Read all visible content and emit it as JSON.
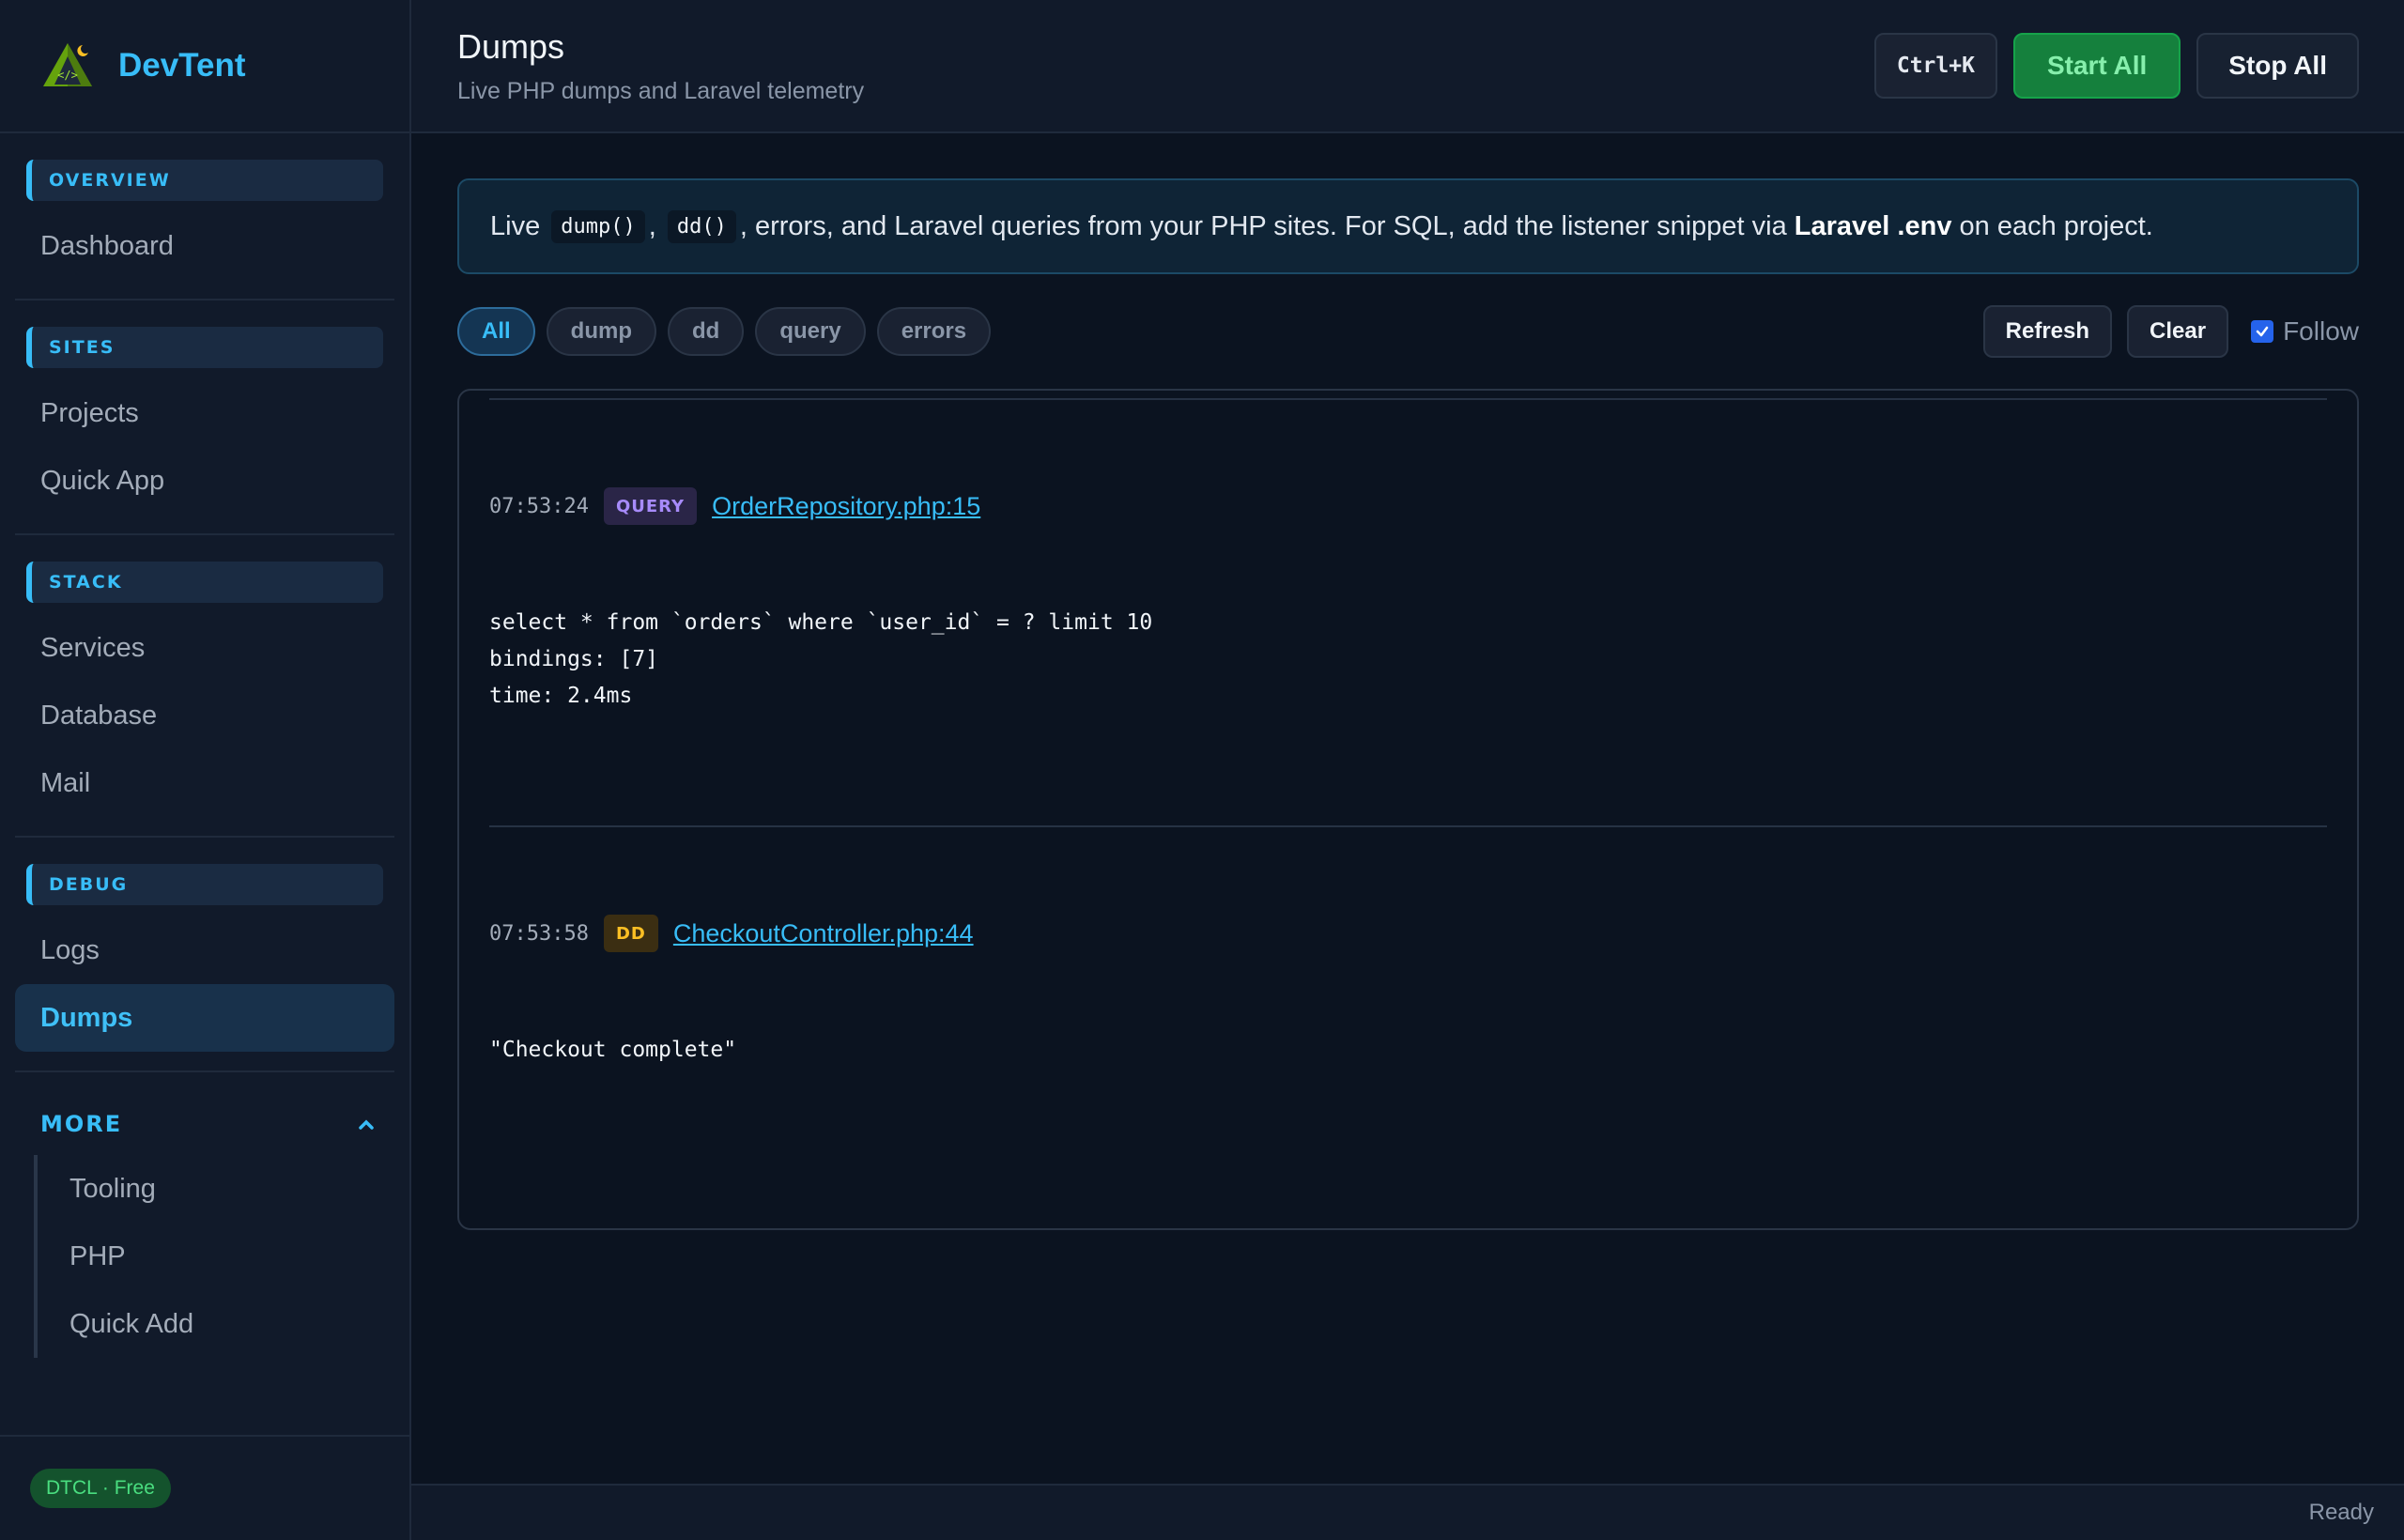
{
  "app": {
    "name": "DevTent",
    "plan_badge": "DTCL · Free"
  },
  "sidebar": {
    "sections": [
      {
        "heading": "OVERVIEW",
        "items": [
          {
            "label": "Dashboard"
          }
        ]
      },
      {
        "heading": "SITES",
        "items": [
          {
            "label": "Projects"
          },
          {
            "label": "Quick App"
          }
        ]
      },
      {
        "heading": "STACK",
        "items": [
          {
            "label": "Services"
          },
          {
            "label": "Database"
          },
          {
            "label": "Mail"
          }
        ]
      },
      {
        "heading": "DEBUG",
        "items": [
          {
            "label": "Logs"
          },
          {
            "label": "Dumps",
            "active": true
          }
        ]
      }
    ],
    "more": {
      "heading": "MORE",
      "expanded": true,
      "items": [
        {
          "label": "Tooling"
        },
        {
          "label": "PHP"
        },
        {
          "label": "Quick Add"
        }
      ]
    }
  },
  "header": {
    "title": "Dumps",
    "subtitle": "Live PHP dumps and Laravel telemetry",
    "shortcut_label": "Ctrl+K",
    "start_label": "Start All",
    "stop_label": "Stop All"
  },
  "banner": {
    "p1": "Live ",
    "code1": "dump()",
    "p2": ", ",
    "code2": "dd()",
    "p3": ", errors, and Laravel queries from your PHP sites. For SQL, add the listener snippet via ",
    "bold": "Laravel .env",
    "p4": " on each project."
  },
  "filters": {
    "chips": [
      {
        "label": "All",
        "active": true
      },
      {
        "label": "dump"
      },
      {
        "label": "dd"
      },
      {
        "label": "query"
      },
      {
        "label": "errors"
      }
    ],
    "refresh_label": "Refresh",
    "clear_label": "Clear",
    "follow_label": "Follow",
    "follow_checked": true
  },
  "entries": [
    {
      "time": "07:53:24",
      "tag": "QUERY",
      "source": "OrderRepository.php:15",
      "body": "select * from `orders` where `user_id` = ? limit 10\nbindings: [7]\ntime: 2.4ms"
    },
    {
      "time": "07:53:58",
      "tag": "DD",
      "source": "CheckoutController.php:44",
      "body": "\"Checkout complete\""
    }
  ],
  "status": {
    "text": "Ready"
  },
  "colors": {
    "accent": "#38bdf8",
    "start_green": "#15803d",
    "query_tag": "#a78bfa",
    "dd_tag": "#fbbf24"
  }
}
